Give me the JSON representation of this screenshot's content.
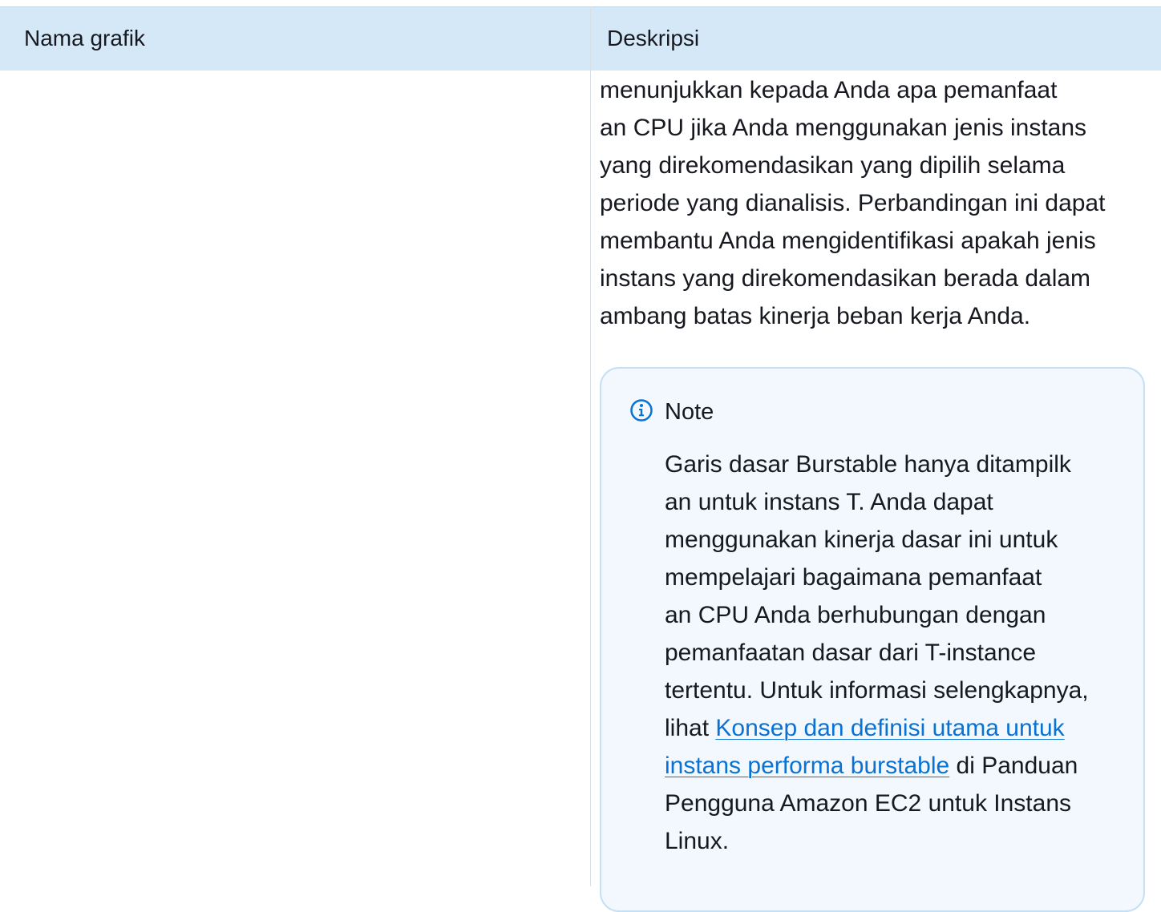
{
  "table": {
    "headers": {
      "name": "Nama grafik",
      "description": "Deskripsi"
    },
    "row": {
      "description_lines": [
        "menunjukkan kepada Anda apa pemanfaat",
        "an CPU jika Anda menggunakan jenis instans",
        "yang direkomendasikan yang dipilih selama",
        "periode yang dianalisis. Perbandingan ini dapat",
        "membantu Anda mengidentifikasi apakah jenis",
        "instans yang direkomendasikan berada dalam",
        "ambang batas kinerja beban kerja Anda."
      ]
    }
  },
  "note": {
    "icon": "info-icon",
    "title": "Note",
    "lines": [
      "Garis dasar Burstable hanya ditampilk",
      "an untuk instans T. Anda dapat",
      "menggunakan kinerja dasar ini untuk",
      "mempelajari bagaimana pemanfaat",
      "an CPU Anda berhubungan dengan",
      "pemanfaatan dasar dari T-instance",
      "tertentu. Untuk informasi selengkapnya,"
    ],
    "link_prefix": "lihat ",
    "link_text_line1": "Konsep dan definisi utama untuk",
    "link_text_line2": "instans performa burstable",
    "after_link": " di Panduan",
    "closing_lines": [
      "Pengguna Amazon EC2 untuk Instans",
      "Linux."
    ]
  },
  "colors": {
    "header_bg": "#d5e8f8",
    "note_bg": "#f2f8fd",
    "note_border": "#c6dff3",
    "link": "#0972d3",
    "info_icon": "#0972d3"
  }
}
